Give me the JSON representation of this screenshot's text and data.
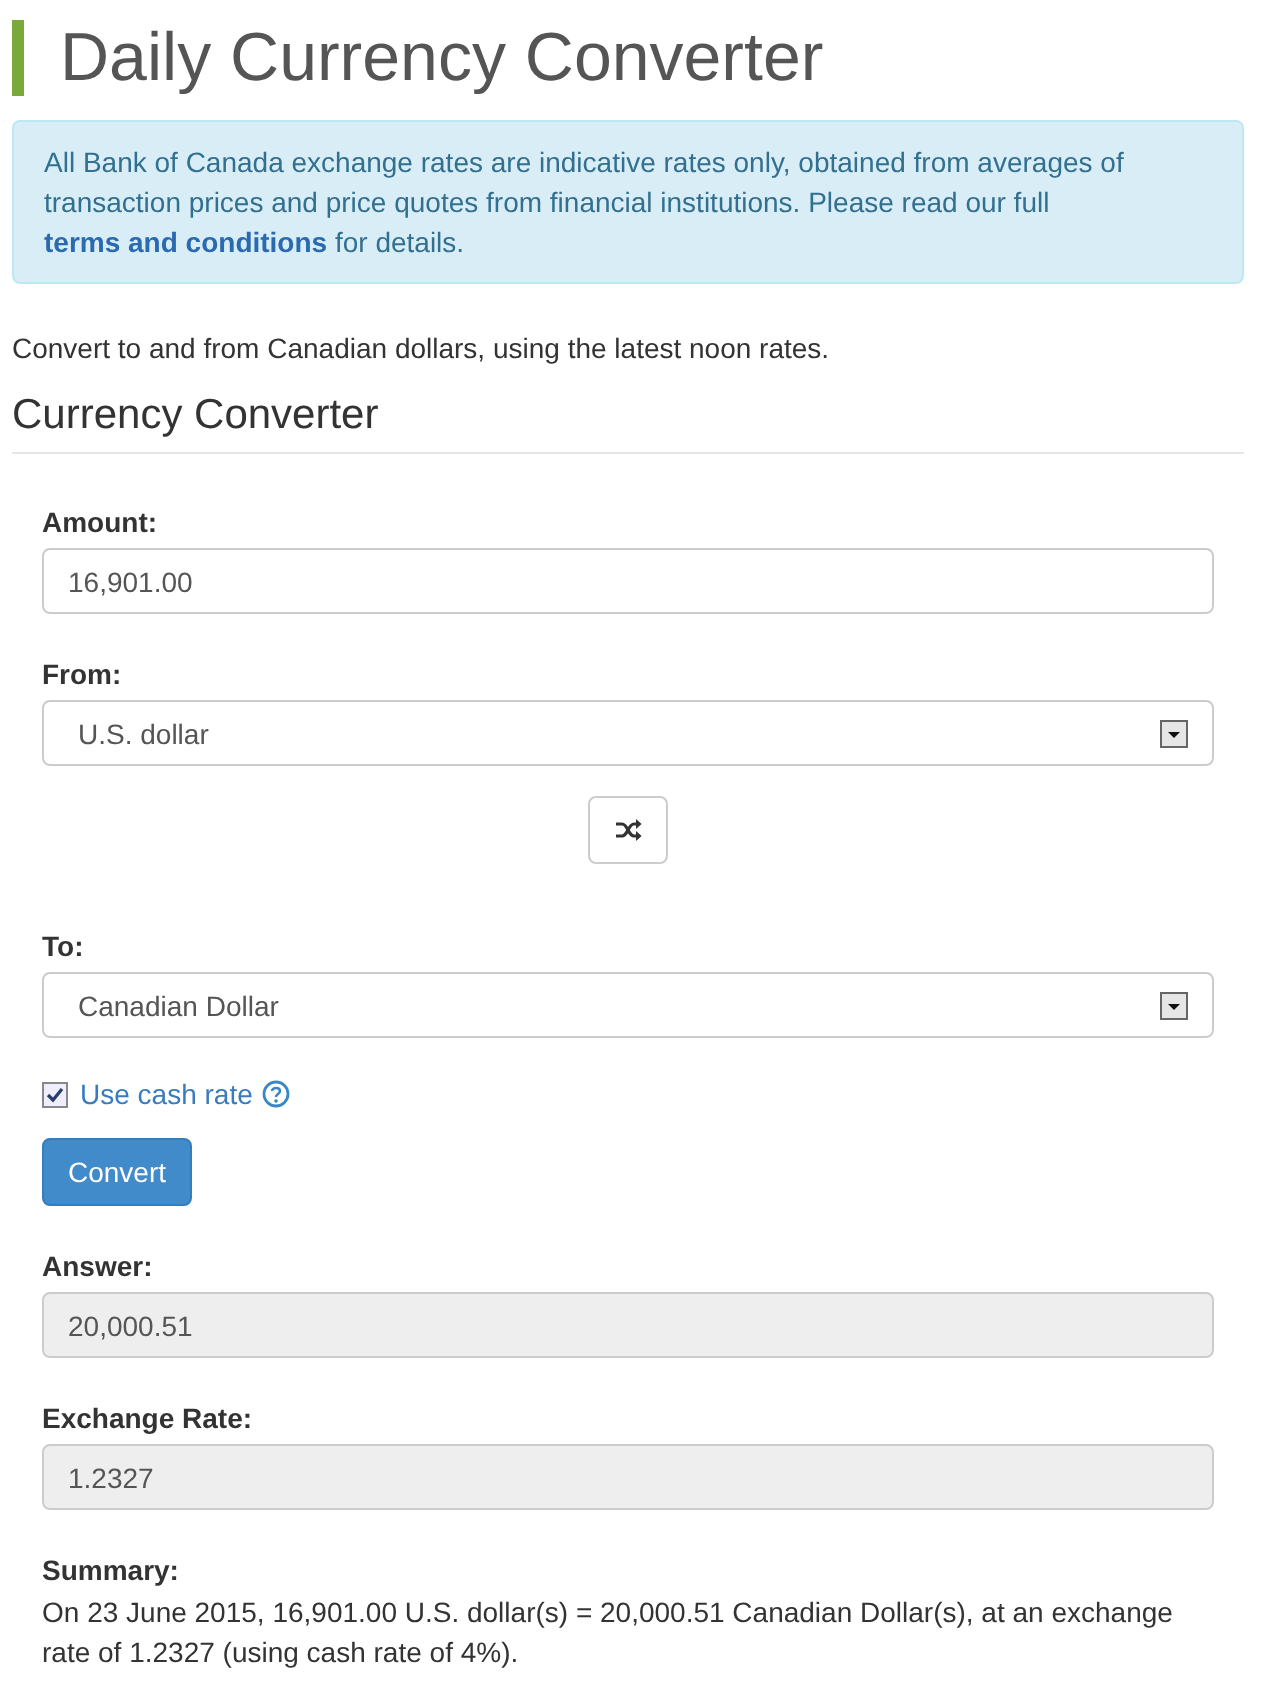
{
  "title": "Daily Currency Converter",
  "notice": {
    "before": "All Bank of Canada exchange rates are indicative rates only, obtained from averages of transaction prices and price quotes from financial institutions. Please read our full ",
    "link": "terms and conditions",
    "after": " for details."
  },
  "intro": "Convert to and from Canadian dollars, using the latest noon rates.",
  "section_title": "Currency Converter",
  "amount": {
    "label": "Amount:",
    "value": "16,901.00"
  },
  "from": {
    "label": "From:",
    "value": "U.S. dollar"
  },
  "to": {
    "label": "To:",
    "value": "Canadian Dollar"
  },
  "cash_rate": {
    "label": "Use cash rate",
    "checked": true
  },
  "convert_button": "Convert",
  "answer": {
    "label": "Answer:",
    "value": "20,000.51"
  },
  "exchange_rate": {
    "label": "Exchange Rate:",
    "value": "1.2327"
  },
  "summary": {
    "label": "Summary:",
    "text": "On 23 June 2015, 16,901.00 U.S. dollar(s) = 20,000.51 Canadian Dollar(s), at an exchange rate of 1.2327 (using cash rate of 4%)."
  }
}
